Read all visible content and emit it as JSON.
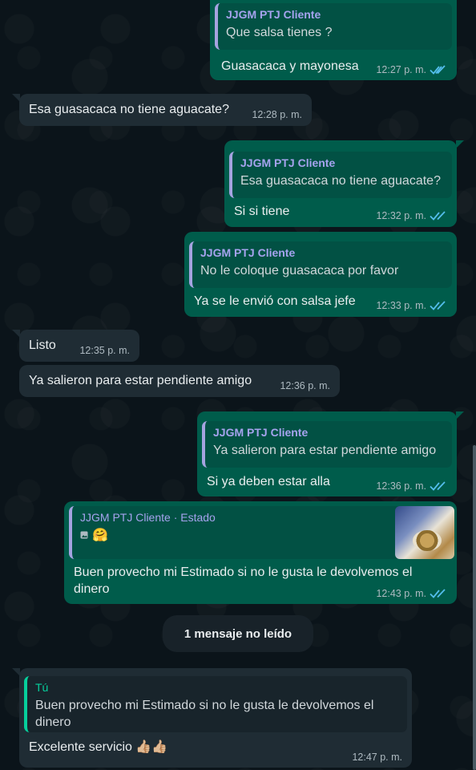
{
  "chat": {
    "messages": [
      {
        "direction": "out",
        "quote": {
          "author": "JJGM PTJ Cliente",
          "text": "Que salsa tienes ?"
        },
        "text": "Guasacaca y mayonesa",
        "time": "12:27 p. m.",
        "read": true
      },
      {
        "direction": "in",
        "text": "Esa guasacaca no tiene aguacate?",
        "time": "12:28 p. m."
      },
      {
        "direction": "out",
        "quote": {
          "author": "JJGM PTJ Cliente",
          "text": "Esa guasacaca no tiene aguacate?"
        },
        "text": "Si si tiene",
        "time": "12:32 p. m.",
        "read": true
      },
      {
        "direction": "out",
        "quote": {
          "author": "JJGM PTJ Cliente",
          "text": "No le coloque guasacaca por favor"
        },
        "text": "Ya se le envió con salsa jefe",
        "time": "12:33 p. m.",
        "read": true
      },
      {
        "direction": "in",
        "text": "Listo",
        "time": "12:35 p. m."
      },
      {
        "direction": "in",
        "text": "Ya salieron para estar pendiente amigo",
        "time": "12:36 p. m."
      },
      {
        "direction": "out",
        "quote": {
          "author": "JJGM PTJ Cliente",
          "text": "Ya salieron para estar pendiente amigo"
        },
        "text": "Si ya deben estar alla",
        "time": "12:36 p. m.",
        "read": true
      },
      {
        "direction": "out",
        "quote": {
          "author": "JJGM PTJ Cliente · Estado",
          "emoji": "🤗"
        },
        "text": "Buen provecho mi Estimado si no le gusta le devolvemos el dinero",
        "time": "12:43 p. m.",
        "read": true
      },
      {
        "direction": "in",
        "quote": {
          "author": "Tú",
          "text": "Buen provecho mi Estimado si no le gusta le devolvemos el dinero"
        },
        "text": "Excelente servicio",
        "emoji": "👍🏼👍🏼",
        "time": "12:47 p. m."
      }
    ],
    "unread_banner": "1 mensaje no leído"
  },
  "colors": {
    "outgoing_bubble": "#005c4b",
    "incoming_bubble": "#1f2c34",
    "read_ticks": "#53bdeb",
    "background": "#0b141a"
  },
  "icons": {
    "read_receipt": "double-check-icon",
    "status_photo": "image-icon"
  }
}
